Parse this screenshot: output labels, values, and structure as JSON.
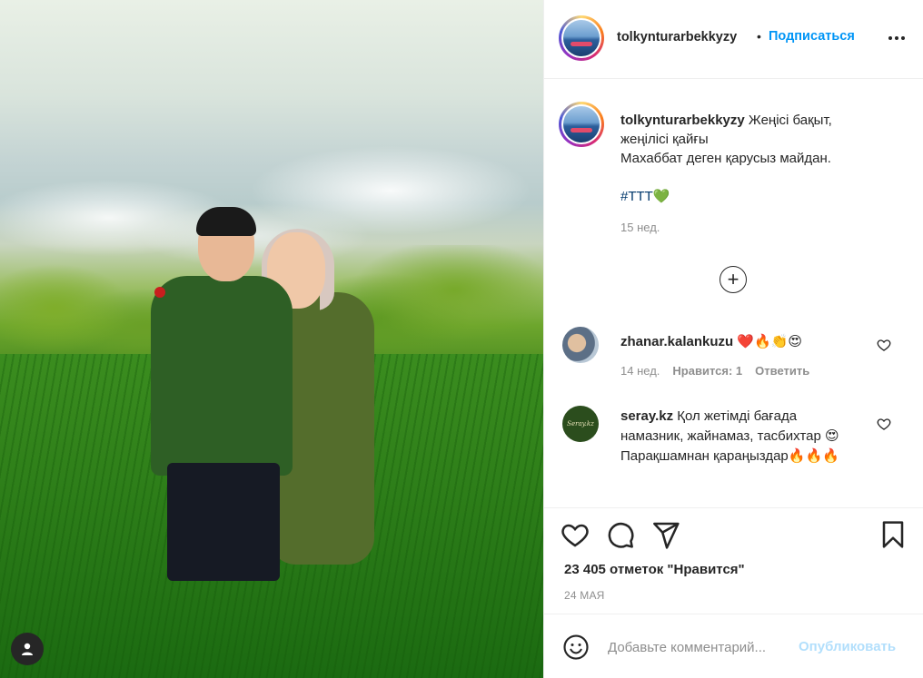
{
  "post": {
    "username": "tolkynturarbekkyzy",
    "dot": "•",
    "follow_label": "Подписаться",
    "more_icon": "more-horizontal-icon"
  },
  "caption": {
    "username": "tolkynturarbekkyzy",
    "line1": "Жеңісі бақыт,",
    "line2": "жеңілісі қайғы",
    "line3": "Махаббат деген қарусыз майдан.",
    "hashtag": "#ТТТ",
    "heart": "💚",
    "time": "15 нед."
  },
  "load_more_icon": "plus-circle-icon",
  "comments": [
    {
      "username": "zhanar.kalankuzu",
      "text": "❤️🔥👏😍",
      "time": "14 нед.",
      "likes": "Нравится: 1",
      "reply": "Ответить"
    },
    {
      "username": "seray.kz",
      "text": "Қол жетімді бағада намазник, жайнамаз, тасбихтар 😍 Парақшамнан қараңыздар🔥🔥🔥",
      "avatar_text": "Seray.kz"
    }
  ],
  "actions": {
    "like_icon": "heart-icon",
    "comment_icon": "comment-icon",
    "share_icon": "paper-plane-icon",
    "save_icon": "bookmark-icon",
    "likes_text": "23 405 отметок \"Нравится\"",
    "date": "24 мая"
  },
  "add_comment": {
    "emoji_icon": "smiley-icon",
    "placeholder": "Добавьте комментарий...",
    "publish_label": "Опубликовать"
  },
  "colors": {
    "link_blue": "#0095f6",
    "publish_disabled": "#b2dffc",
    "hashtag": "#00376b",
    "muted": "#8e8e8e",
    "text": "#262626"
  }
}
